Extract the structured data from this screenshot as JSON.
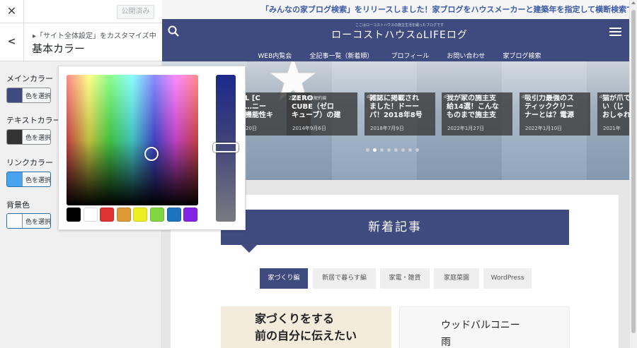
{
  "customizer": {
    "publish_label": "公開済み",
    "breadcrumb": "▸「サイト全体設定」をカスタマイズ中",
    "title": "基本カラー",
    "close_icon": "close-icon",
    "back_icon": "chevron-left-icon",
    "colors": [
      {
        "label": "メインカラー",
        "button": "色を選択",
        "color": "#3f4a7e"
      },
      {
        "label": "テキストカラー",
        "button": "色を選択",
        "color": "#333333"
      },
      {
        "label": "リンクカラー",
        "button": "色を選択",
        "color": "#4aa3f0"
      },
      {
        "label": "背景色",
        "button": "色を選択",
        "color": "#f9f9f9"
      }
    ],
    "palette": [
      "#000000",
      "#ffffff",
      "#dd3333",
      "#dd9933",
      "#eeee22",
      "#81d742",
      "#1e73be",
      "#8224e3"
    ]
  },
  "site": {
    "notice": "「みんなの家ブログ検索」をリリースしました！家ブログをハウスメーカーと建築年を指定して横断検索できるサ",
    "tagline": "ここはローコストハウスの施主生活を綴ったブログです",
    "logo": "ローコストハウス⌂LIFEログ",
    "nav": [
      "WEB内覧会",
      "全記事一覧（新着順）",
      "プロフィール",
      "お問い合わせ",
      "家ブログ検索"
    ],
    "brand_color": "#3f4a7e",
    "slides": [
      {
        "category": "",
        "title": "L [C\n…ニー\n機能性キ",
        "date": "20日"
      },
      {
        "category": "ZERO CUBE解約編",
        "title": "ZERO\nCUBE（ゼロ\nキューブ）の建",
        "date": "2014年9月6日"
      },
      {
        "category": "d",
        "title": "雑誌に掲載され\nました！ドーー\nパ！2018年8号",
        "date": "2018年7月9日"
      },
      {
        "category": "d",
        "title": "我が家の施主支\n給14選！こんな\nものまで施主支",
        "date": "2022年1月27日"
      },
      {
        "category": "d",
        "title": "吸引力最強のス\nティッククリー\nナーとは？電源",
        "date": "2022年1月10日"
      },
      {
        "category": "d",
        "title": "猫が爪で\nい（じ\nおしゃれ",
        "date": "2021年"
      }
    ],
    "section_title": "新着記事",
    "tabs": [
      "家づくり編",
      "新居で暮らす編",
      "家電・雑貨",
      "家庭菜園",
      "WordPress"
    ],
    "thumb1_text": "家づくりをする\n前の自分に伝えたい",
    "thumb2_text": "ウッドバルコニー\n雨"
  }
}
